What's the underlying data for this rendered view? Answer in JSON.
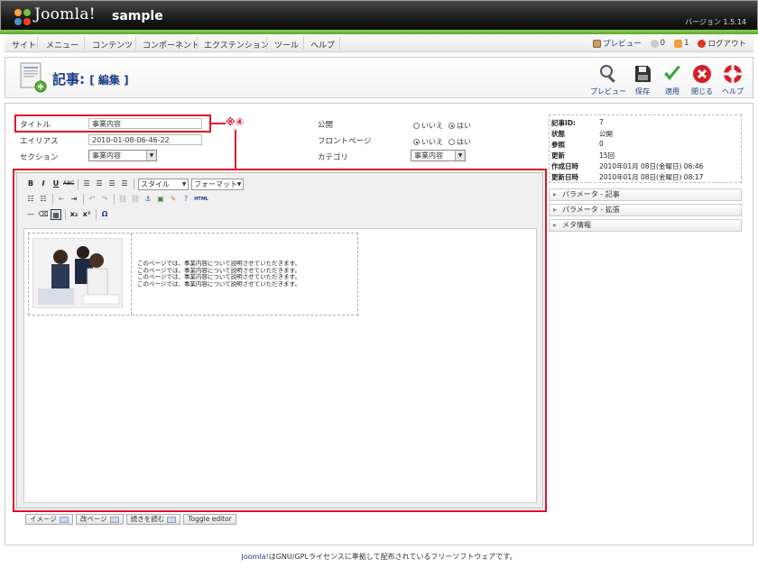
{
  "header": {
    "logo_text": "Joomla!",
    "site_name": "sample",
    "version": "バージョン 1.5.14"
  },
  "menu": {
    "items": [
      "サイト",
      "メニュー",
      "コンテンツ",
      "コンポーネント",
      "エクステンション",
      "ツール",
      "ヘルプ"
    ]
  },
  "status": {
    "preview": "プレビュー",
    "messages_count": "0",
    "users_count": "1",
    "logout": "ログアウト"
  },
  "toolbar": {
    "title": "記事:",
    "subtitle": "[ 編集 ]",
    "buttons": [
      "プレビュー",
      "保存",
      "適用",
      "閉じる",
      "ヘルプ"
    ]
  },
  "form": {
    "title_label": "タイトル",
    "title_value": "事業内容",
    "alias_label": "エイリアス",
    "alias_value": "2010-01-08-06-46-22",
    "section_label": "セクション",
    "section_value": "事業内容",
    "published_label": "公開",
    "frontpage_label": "フロントページ",
    "category_label": "カテゴリ",
    "category_value": "事業内容",
    "no_label": "いいえ",
    "yes_label": "はい"
  },
  "callout": {
    "marker": "※④"
  },
  "editor": {
    "style_select": "スタイル",
    "format_select": "フォーマット",
    "html_label": "HTML",
    "content_lines": [
      "このページでは、事業内容について説明させていただきます。",
      "このページでは、事業内容について説明させていただきます。",
      "このページでは、事業内容について説明させていただきます。",
      "このページでは、事業内容について説明させていただきます。"
    ],
    "buttons": [
      "イメージ",
      "改ページ",
      "続きを読む",
      "Toggle editor"
    ]
  },
  "details": {
    "labels": [
      "記事ID:",
      "状態",
      "参照",
      "更新",
      "作成日時",
      "更新日時"
    ],
    "values": [
      "7",
      "公開",
      "0",
      "15回",
      "2010年01月 08日(金曜日) 06:46",
      "2010年01月 08日(金曜日) 08:17"
    ]
  },
  "panels": [
    "パラメータ - 記事",
    "パラメータ - 拡張",
    "メタ情報"
  ],
  "footer": {
    "link": "Joomla!",
    "text": "はGNU/GPLライセンスに準拠して配布されているフリーソフトウェアです。"
  },
  "colors": {
    "accent_red": "#e0102a",
    "link_blue": "#1a3c8a",
    "header_green": "#6cbb3c"
  }
}
